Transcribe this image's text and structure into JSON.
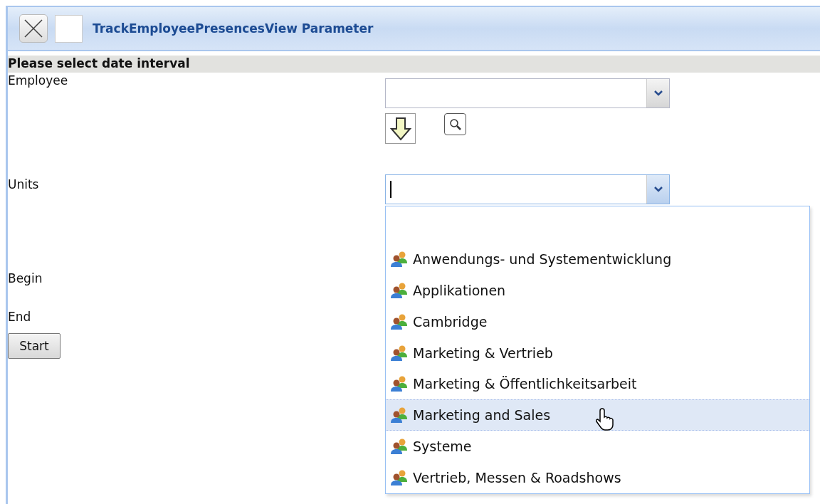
{
  "window": {
    "title": "TrackEmployeePresencesView Parameter"
  },
  "section": {
    "title": "Please select date interval"
  },
  "fields": [
    {
      "label": "Employee",
      "kind": "lookup"
    },
    {
      "label": "Units",
      "kind": "dropdown",
      "expanded": true,
      "options": [
        {
          "label": "Anwendungs- und Systementwicklung",
          "selected": false
        },
        {
          "label": "Applikationen",
          "selected": false
        },
        {
          "label": "Cambridge",
          "selected": false
        },
        {
          "label": "Marketing & Vertrieb",
          "selected": false
        },
        {
          "label": "Marketing & Öffentlichkeitsarbeit",
          "selected": false
        },
        {
          "label": "Marketing and Sales",
          "selected": true
        },
        {
          "label": "Systeme",
          "selected": false
        },
        {
          "label": "Vertrieb, Messen & Roadshows",
          "selected": false
        }
      ]
    },
    {
      "label": "Begin",
      "kind": "plain"
    },
    {
      "label": "End",
      "kind": "plain"
    }
  ],
  "start_button": {
    "label": "Start"
  }
}
